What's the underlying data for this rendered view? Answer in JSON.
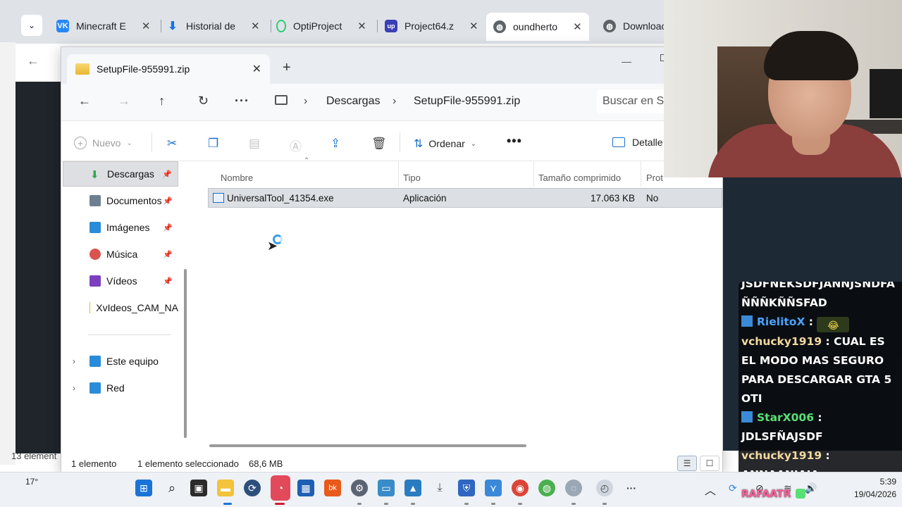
{
  "browser": {
    "tabs": [
      {
        "label": "Minecraft E",
        "icon": "vk-icon",
        "color": "#2787f5"
      },
      {
        "label": "Historial de",
        "icon": "download-icon",
        "color": "#1a73e8"
      },
      {
        "label": "OptiProject",
        "icon": "optifine-icon",
        "color": "#2ecc71"
      },
      {
        "label": "Project64.z",
        "icon": "up-icon",
        "color": "#3b3fb6"
      },
      {
        "label": "oundherto",
        "icon": "globe-icon",
        "color": "#5f6368"
      },
      {
        "label": "Downloac",
        "icon": "globe-icon",
        "color": "#5f6368"
      }
    ],
    "status_left": "13 element"
  },
  "explorer": {
    "tab_title": "SetupFile-955991.zip",
    "breadcrumb": [
      "Descargas",
      "SetupFile-955991.zip"
    ],
    "search_placeholder": "Buscar en Se",
    "toolbar": {
      "new_label": "Nuevo",
      "sort_label": "Ordenar",
      "details_label": "Detalle"
    },
    "sidebar": [
      {
        "label": "Descargas",
        "icon": "download-icon",
        "color": "#2fa84f",
        "pinned": true
      },
      {
        "label": "Documentos",
        "icon": "document-icon",
        "color": "#6f7f92",
        "pinned": true
      },
      {
        "label": "Imágenes",
        "icon": "image-icon",
        "color": "#2a8bd8",
        "pinned": true
      },
      {
        "label": "Música",
        "icon": "music-icon",
        "color": "#d9534f",
        "pinned": true
      },
      {
        "label": "Vídeos",
        "icon": "video-icon",
        "color": "#7b3fbf",
        "pinned": true
      },
      {
        "label": "XvIdeos_CAM_NA",
        "icon": "folder-icon",
        "color": "#e9b72f",
        "pinned": false
      }
    ],
    "sidebar_roots": [
      {
        "label": "Este equipo",
        "icon": "computer-icon",
        "color": "#2a8bd8"
      },
      {
        "label": "Red",
        "icon": "network-icon",
        "color": "#2a8bd8"
      }
    ],
    "columns": [
      "Nombre",
      "Tipo",
      "Tamaño comprimido",
      "Prot"
    ],
    "files": [
      {
        "name": "UniversalTool_41354.exe",
        "type": "Aplicación",
        "size": "17.063 KB",
        "protected": "No"
      }
    ],
    "status": {
      "count": "1 elemento",
      "selected": "1 elemento seleccionado",
      "size": "68,6 MB"
    }
  },
  "chat": {
    "messages": [
      {
        "user": "",
        "text": "JSDFNEKSDFJANNJSNDFA"
      },
      {
        "user": "",
        "text": "ÑÑÑKÑÑSFAD"
      },
      {
        "user": "RielitoX",
        "text": ""
      },
      {
        "user": "vchucky1919",
        "text": "CUAL ES EL MODO MAS SEGURO PARA DESCARGAR GTA 5 OTI"
      },
      {
        "user": "StarX006",
        "text": "JDLSFÑAJSDF"
      },
      {
        "user": "vchucky1919",
        "text": "ANNAANJAJA"
      }
    ],
    "overlay_name": "RAFAATR"
  },
  "taskbar": {
    "temperature": "17°",
    "time": "5:39",
    "date": "19/04/2026"
  }
}
